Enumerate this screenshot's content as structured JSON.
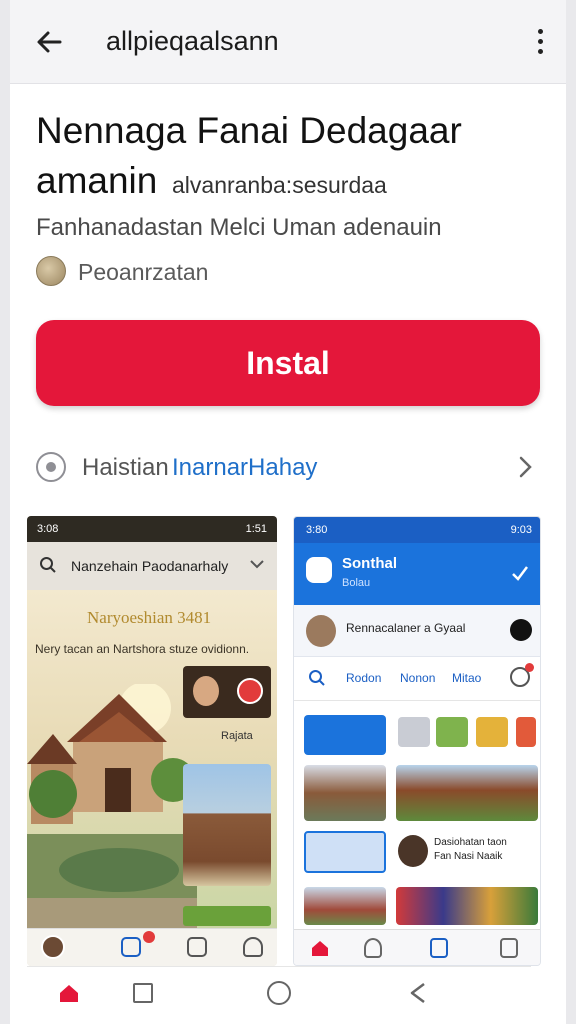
{
  "topbar": {
    "title": "allpieqaalsann"
  },
  "app": {
    "name_line1": "Nennaga Fanai Dedagaar",
    "name_line2": "amanin",
    "name_suffix": "alvanranba:sesurdaa",
    "developer": "Fanhanadastan Melci Uman adenauin",
    "publisher": "Peoanrzatan"
  },
  "install": {
    "label": "Instal"
  },
  "link_row": {
    "prefix": "Haistian",
    "link": "InarnarHahay"
  },
  "screenshot1": {
    "status_time": "3:08",
    "status_right": "1:51",
    "search_text": "Nanzehain Paodanarhaly",
    "headline": "Naryoeshian 3481",
    "subline": "Nery tacan an Nartshora stuze ovidionn.",
    "tag": "Rajata"
  },
  "screenshot2": {
    "status_time": "3:80",
    "status_right": "9:03",
    "header_title": "Sonthal",
    "header_sub": "Bolau",
    "profile_name": "Rennacalaner a Gyaal",
    "tabs": [
      "Rodon",
      "Nonon",
      "Mitao"
    ],
    "item_text1": "Dasiohatan taon",
    "item_text2": "Fan Nasi Naaik"
  },
  "colors": {
    "install_red": "#e4173a",
    "link_blue": "#1f6fc9",
    "brand_blue": "#1b73dc"
  }
}
